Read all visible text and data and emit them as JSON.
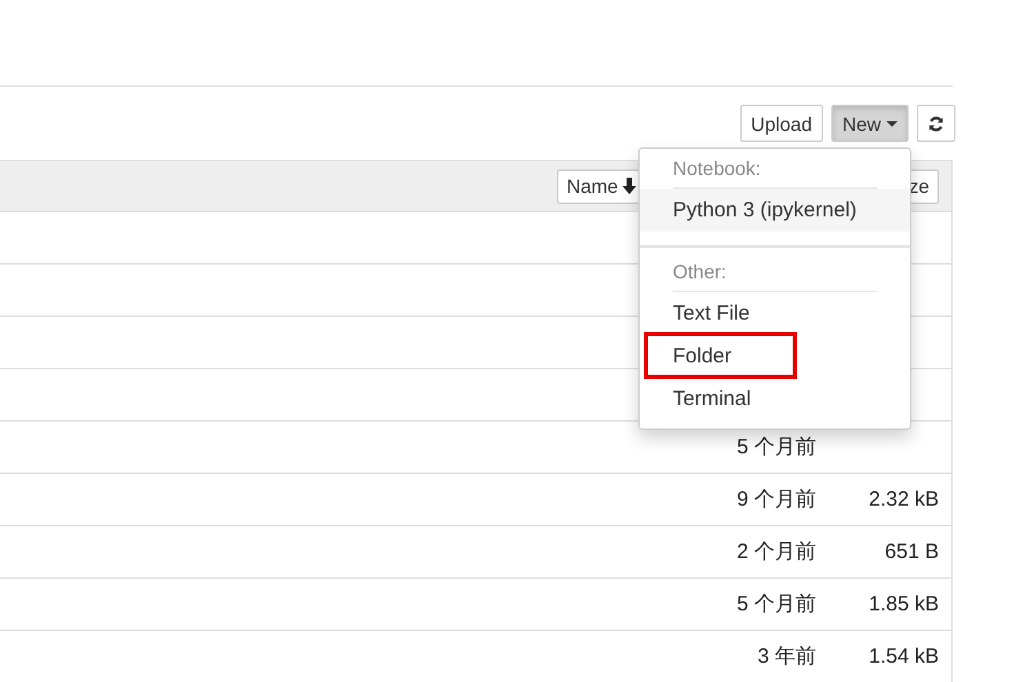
{
  "toolbar": {
    "upload": "Upload",
    "new": "New",
    "new_open": true
  },
  "table": {
    "header": {
      "name": "Name",
      "size": "ze"
    },
    "rows": [
      {
        "modified": "",
        "size": ""
      },
      {
        "modified": "",
        "size": ""
      },
      {
        "modified": "",
        "size": ""
      },
      {
        "modified": "",
        "size": ""
      },
      {
        "modified": "5 个月前",
        "size": ""
      },
      {
        "modified": "9 个月前",
        "size": "2.32 kB"
      },
      {
        "modified": "2 个月前",
        "size": "651 B"
      },
      {
        "modified": "5 个月前",
        "size": "1.85 kB"
      },
      {
        "modified": "3 年前",
        "size": "1.54 kB"
      }
    ]
  },
  "new_menu": [
    {
      "header": "Notebook:",
      "items": [
        {
          "label": "Python 3 (ipykernel)",
          "hovered": true,
          "highlighted": false
        }
      ]
    },
    {
      "header": "Other:",
      "items": [
        {
          "label": "Text File",
          "hovered": false,
          "highlighted": false
        },
        {
          "label": "Folder",
          "hovered": false,
          "highlighted": true
        },
        {
          "label": "Terminal",
          "hovered": false,
          "highlighted": false
        }
      ]
    }
  ]
}
